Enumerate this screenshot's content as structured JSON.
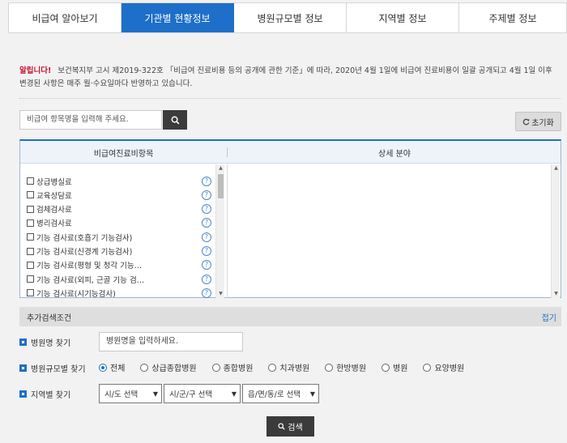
{
  "tabs": [
    {
      "label": "비급여 알아보기",
      "active": false
    },
    {
      "label": "기관별 현황정보",
      "active": true
    },
    {
      "label": "병원규모별 정보",
      "active": false
    },
    {
      "label": "지역별 정보",
      "active": false
    },
    {
      "label": "주제별 정보",
      "active": false
    }
  ],
  "notice": {
    "alert_label": "알립니다!",
    "text": "보건복지부 고시 제2019-322호 「비급여 진료비용 등의 공개에 관한 기준」에 따라, 2020년 4월 1일에 비급여 진료비용이 일괄 공개되고 4월 1일 이후 변경된 사항은 매주 월·수요일마다 반영하고 있습니다."
  },
  "search": {
    "placeholder": "비급여 항목명을 입력해 주세요.",
    "search_icon": "search-icon",
    "reset_label": "초기화",
    "reset_icon": "refresh-icon"
  },
  "table": {
    "col_left": "비급여진료비항목",
    "col_right": "상세 분야",
    "items": [
      "상급병실료",
      "교육상담료",
      "검체검사료",
      "병리검사료",
      "기능 검사료(호흡기 기능검사)",
      "기능 검사료(신경계 기능검사)",
      "기능 검사료(평형 및 청각 기능…",
      "기능 검사료(외피, 근골 기능 검…",
      "기능 검사료(시기능검사)"
    ],
    "help_icon": "help-icon",
    "scroll_position": 0.05
  },
  "extra": {
    "title": "추가검색조건",
    "fold_label": "접기",
    "hospital_label": "병원명 찾기",
    "hospital_placeholder": "병원명을 입력하세요.",
    "size_label": "병원규모별 찾기",
    "size_options": [
      "전체",
      "상급종합병원",
      "종합병원",
      "치과병원",
      "한방병원",
      "병원",
      "요양병원"
    ],
    "size_selected": "전체",
    "region_label": "지역별 찾기",
    "region_selects": [
      "시/도 선택",
      "시/군/구 선택",
      "읍/면/동/로 선택"
    ],
    "submit_label": "검색"
  },
  "colors": {
    "accent": "#1e6fc9",
    "alert": "#c8102e",
    "dark_button": "#3b3b3b"
  }
}
